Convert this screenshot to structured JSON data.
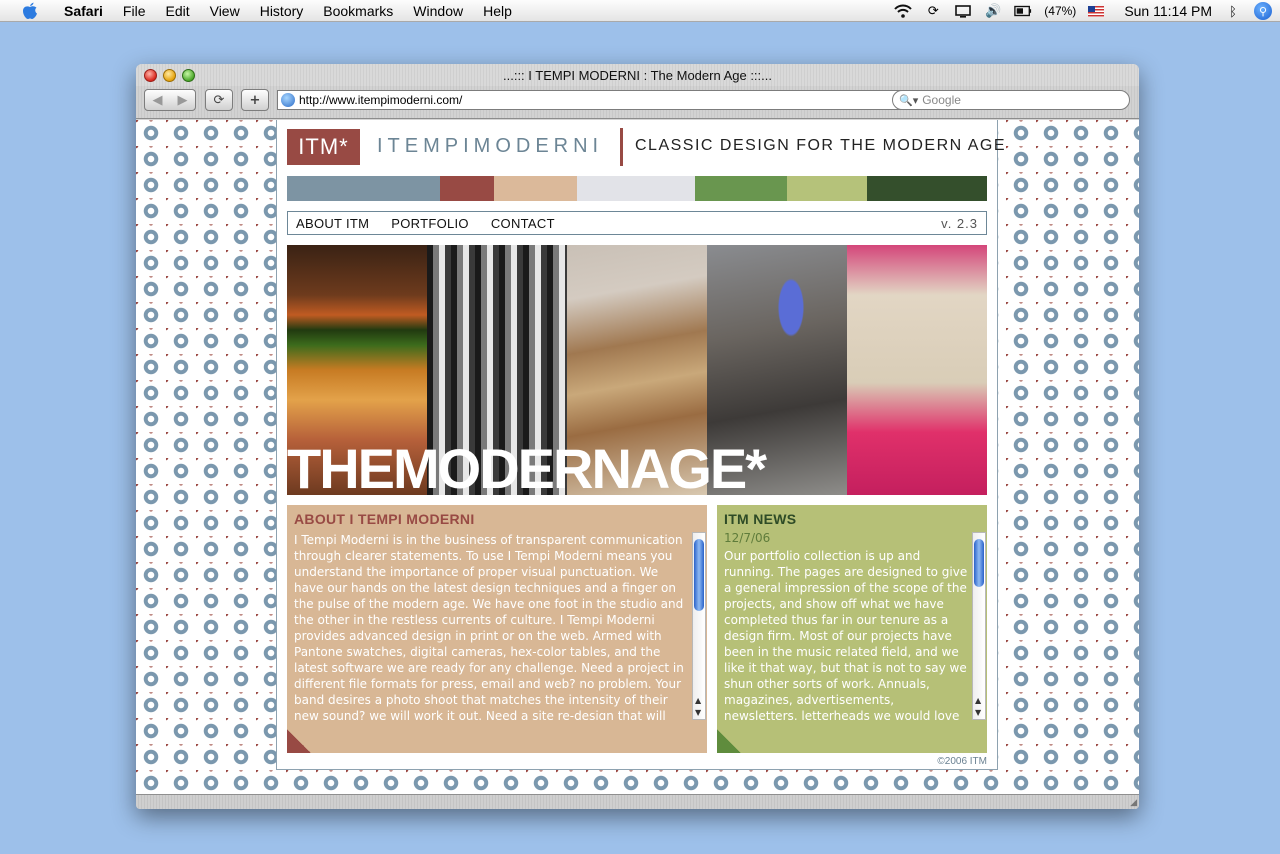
{
  "menubar": {
    "app": "Safari",
    "items": [
      "File",
      "Edit",
      "View",
      "History",
      "Bookmarks",
      "Window",
      "Help"
    ],
    "battery": "(47%)",
    "clock": "Sun 11:14 PM"
  },
  "window": {
    "title": "...::: I TEMPI MODERNI : The Modern Age :::...",
    "url": "http://www.itempimoderni.com/",
    "search_placeholder": "Google"
  },
  "site": {
    "logo": "ITM*",
    "brand": "ITEMPIMODERNI",
    "tagline": "CLASSIC DESIGN FOR THE MODERN AGE",
    "swatch_colors": [
      "#7d94a3",
      "#984a44",
      "#dbb99a",
      "#e2e3e8",
      "#69964f",
      "#b5c27a",
      "#344f2c"
    ],
    "nav": {
      "about": "ABOUT ITM",
      "portfolio": "PORTFOLIO",
      "contact": "CONTACT",
      "version": "v. 2.3"
    },
    "hero_title": "THEMODERNAGE*",
    "about": {
      "heading": "ABOUT I TEMPI MODERNI",
      "text": "I Tempi Moderni is in the business of transparent communication through clearer statements. To use I Tempi Moderni means you understand the importance of proper visual punctuation. We have our hands on the latest design techniques and a finger on the pulse of the modern age. We have one foot in the studio and the other in the restless currents of culture. I Tempi Moderni provides advanced design in print or on the web. Armed with Pantone swatches, digital cameras, hex-color tables, and the latest software we are ready for any challenge. Need a project in different file formats for press, email and web? no problem. Your band desires a photo shoot that matches the intensity of their new sound? we will work it out. Need a site re-design that will"
    },
    "news": {
      "heading": "ITM NEWS",
      "date": "12/7/06",
      "text": "Our portfolio collection is up and running. The pages are designed to give a general impression of the scope of the projects, and show off what we have completed thus far in our tenure as a design firm. Most of our projects have been in the music related field, and we like it that way, but that is not to say we shun other sorts of work. Annuals, magazines, advertisements, newsletters, letterheads we would love to do it all"
    },
    "copyright": "©2006 ITM"
  }
}
